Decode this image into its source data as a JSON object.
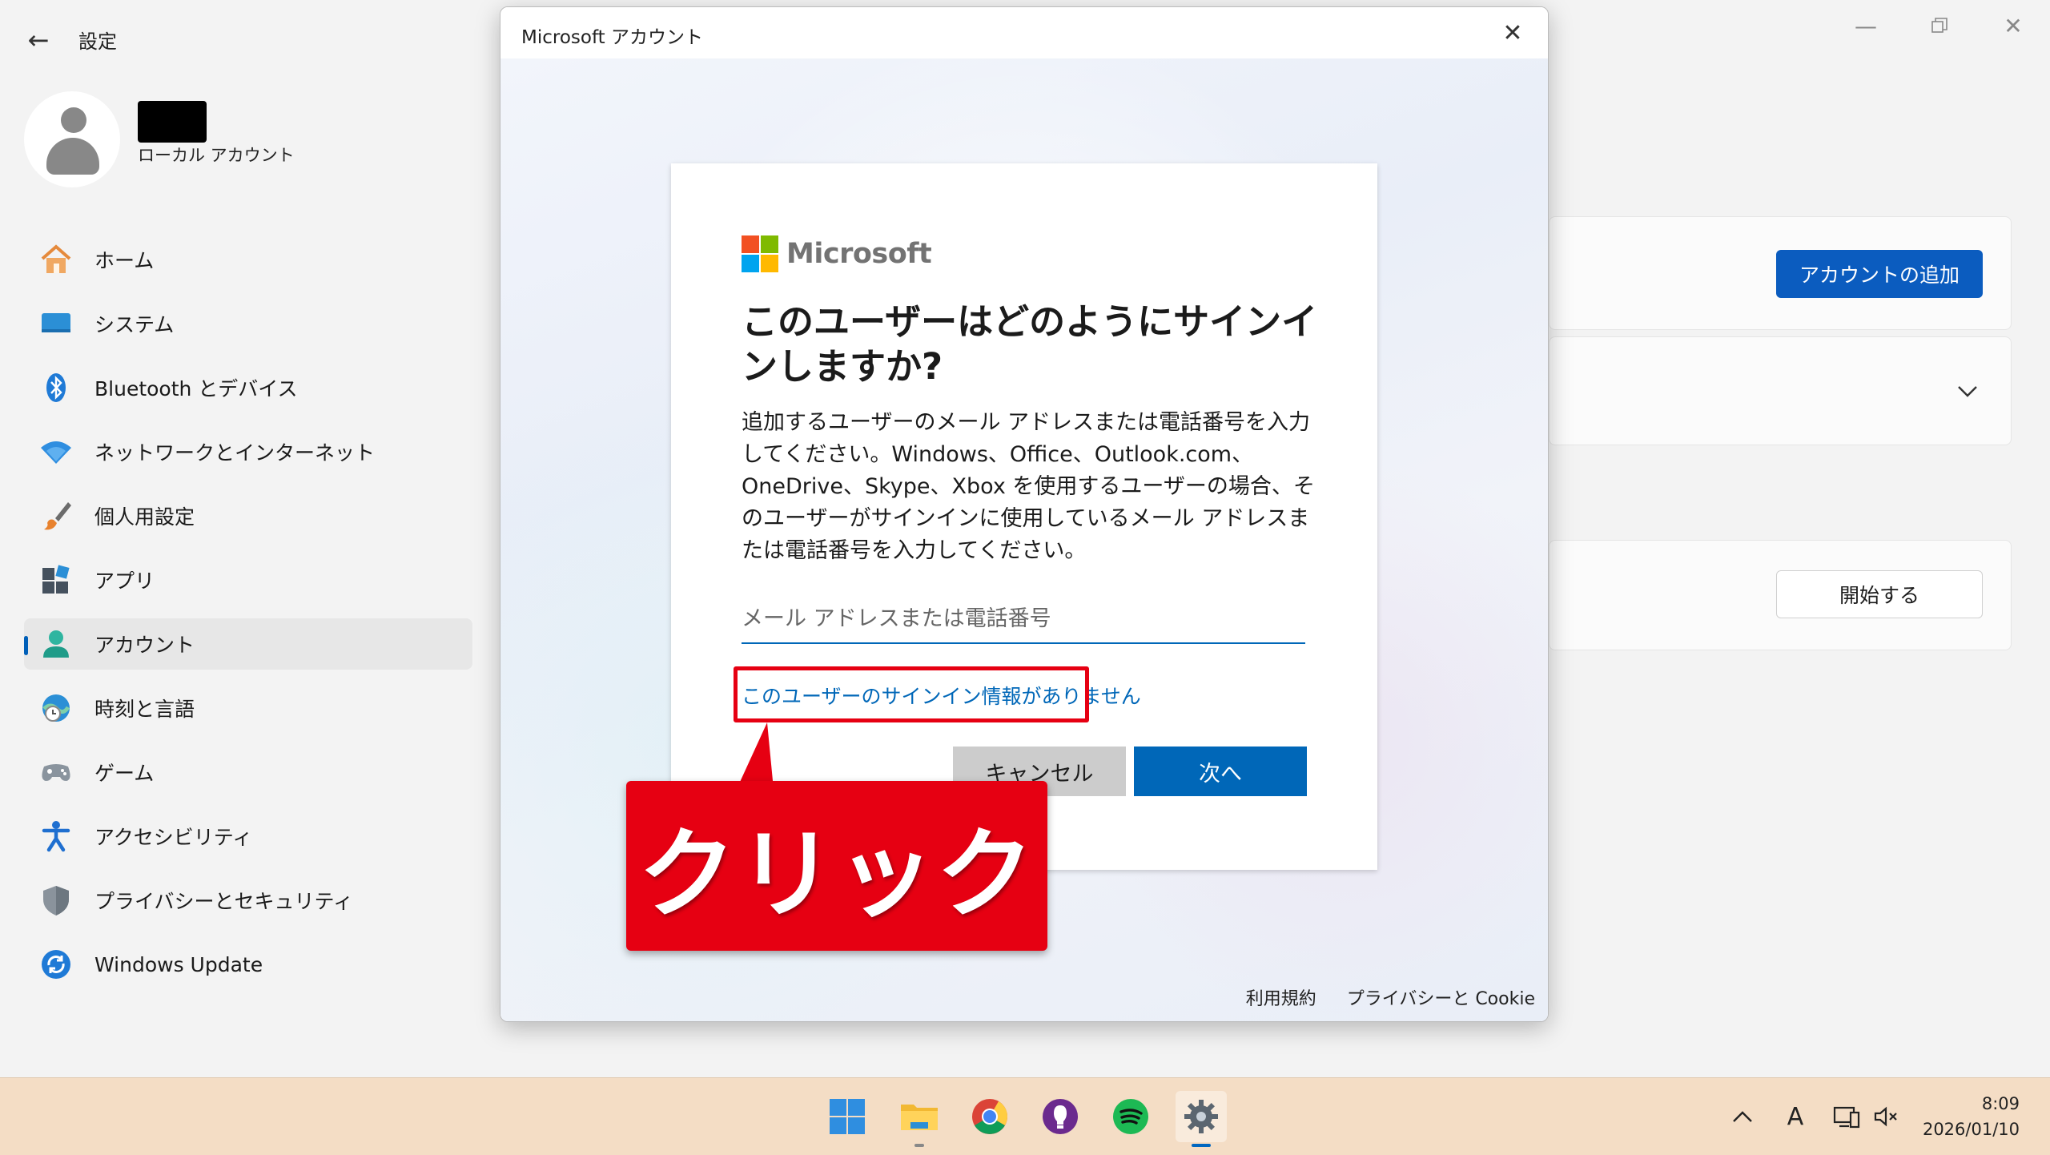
{
  "settings": {
    "title": "設定",
    "account": {
      "type": "ローカル アカウント"
    },
    "nav": [
      {
        "label": "ホーム",
        "icon": "home-icon",
        "active": false
      },
      {
        "label": "システム",
        "icon": "system-icon",
        "active": false
      },
      {
        "label": "Bluetooth とデバイス",
        "icon": "bluetooth-icon",
        "active": false
      },
      {
        "label": "ネットワークとインターネット",
        "icon": "wifi-icon",
        "active": false
      },
      {
        "label": "個人用設定",
        "icon": "brush-icon",
        "active": false
      },
      {
        "label": "アプリ",
        "icon": "apps-icon",
        "active": false
      },
      {
        "label": "アカウント",
        "icon": "account-icon",
        "active": true
      },
      {
        "label": "時刻と言語",
        "icon": "time-language-icon",
        "active": false
      },
      {
        "label": "ゲーム",
        "icon": "gamepad-icon",
        "active": false
      },
      {
        "label": "アクセシビリティ",
        "icon": "accessibility-icon",
        "active": false
      },
      {
        "label": "プライバシーとセキュリティ",
        "icon": "shield-icon",
        "active": false
      },
      {
        "label": "Windows Update",
        "icon": "update-icon",
        "active": false
      }
    ],
    "main": {
      "add_account_label": "アカウントの追加",
      "start_label": "開始する"
    }
  },
  "dialog": {
    "title": "Microsoft アカウント",
    "brand": "Microsoft",
    "heading": "このユーザーはどのようにサインインしますか?",
    "description": "追加するユーザーのメール アドレスまたは電話番号を入力してください。Windows、Office、Outlook.com、OneDrive、Skype、Xbox を使用するユーザーの場合、そのユーザーがサインインに使用しているメール アドレスまたは電話番号を入力してください。",
    "email_placeholder": "メール アドレスまたは電話番号",
    "email_value": "",
    "no_signin_info_link": "このユーザーのサインイン情報がありません",
    "cancel_label": "キャンセル",
    "next_label": "次へ",
    "footer": {
      "terms": "利用規約",
      "privacy": "プライバシーと Cookie"
    }
  },
  "annotation": {
    "callout_text": "クリック",
    "color": "#e60012"
  },
  "taskbar": {
    "apps": [
      {
        "icon": "windows-start-icon"
      },
      {
        "icon": "file-explorer-icon"
      },
      {
        "icon": "chrome-icon"
      },
      {
        "icon": "smart-bulb-icon"
      },
      {
        "icon": "spotify-icon"
      },
      {
        "icon": "settings-gear-icon"
      }
    ],
    "ime_indicator": "A",
    "time": "8:09",
    "date": "2026/01/10"
  },
  "colors": {
    "accent": "#0067b8",
    "settings_accent": "#0b5cbf",
    "callout_red": "#e60012",
    "taskbar": "#f4ddc5",
    "ms_red": "#f25022",
    "ms_green": "#7fba00",
    "ms_blue": "#00a4ef",
    "ms_yellow": "#ffb900"
  }
}
